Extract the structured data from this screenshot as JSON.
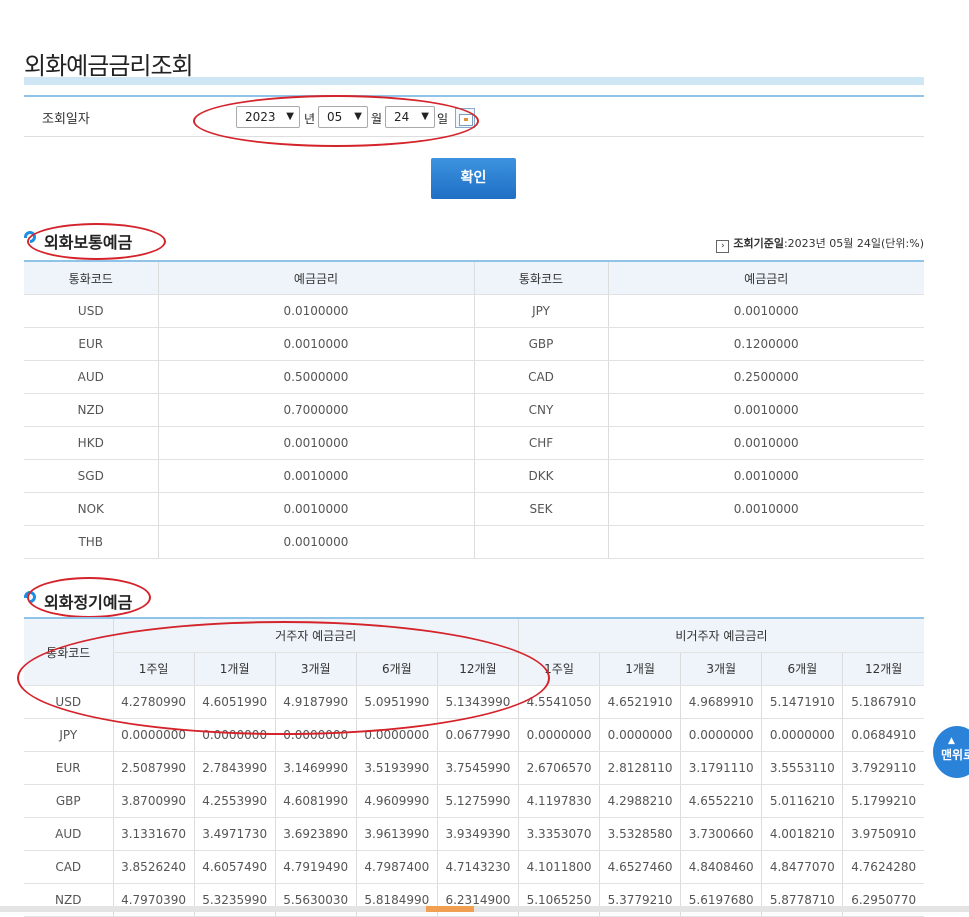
{
  "page": {
    "title": "외화예금금리조회"
  },
  "search": {
    "label": "조회일자",
    "year": "2023",
    "year_unit": "년",
    "month": "05",
    "month_unit": "월",
    "day": "24",
    "day_unit": "일",
    "confirm_label": "확인"
  },
  "ordinary": {
    "title": "외화보통예금",
    "ref_prefix": "조회기준일",
    "ref_text": ":2023년 05월 24일(단위:%)",
    "headers": [
      "통화코드",
      "예금금리",
      "통화코드",
      "예금금리"
    ],
    "rows": [
      [
        "USD",
        "0.0100000",
        "JPY",
        "0.0010000"
      ],
      [
        "EUR",
        "0.0010000",
        "GBP",
        "0.1200000"
      ],
      [
        "AUD",
        "0.5000000",
        "CAD",
        "0.2500000"
      ],
      [
        "NZD",
        "0.7000000",
        "CNY",
        "0.0010000"
      ],
      [
        "HKD",
        "0.0010000",
        "CHF",
        "0.0010000"
      ],
      [
        "SGD",
        "0.0010000",
        "DKK",
        "0.0010000"
      ],
      [
        "NOK",
        "0.0010000",
        "SEK",
        "0.0010000"
      ],
      [
        "THB",
        "0.0010000",
        "",
        ""
      ]
    ]
  },
  "term": {
    "title": "외화정기예금",
    "code_header": "통화코드",
    "resident_header": "거주자 예금금리",
    "nonresident_header": "비거주자 예금금리",
    "periods": [
      "1주일",
      "1개월",
      "3개월",
      "6개월",
      "12개월"
    ],
    "rows": [
      [
        "USD",
        "4.2780990",
        "4.6051990",
        "4.9187990",
        "5.0951990",
        "5.1343990",
        "4.5541050",
        "4.6521910",
        "4.9689910",
        "5.1471910",
        "5.1867910"
      ],
      [
        "JPY",
        "0.0000000",
        "0.0000000",
        "0.0000000",
        "0.0000000",
        "0.0677990",
        "0.0000000",
        "0.0000000",
        "0.0000000",
        "0.0000000",
        "0.0684910"
      ],
      [
        "EUR",
        "2.5087990",
        "2.7843990",
        "3.1469990",
        "3.5193990",
        "3.7545990",
        "2.6706570",
        "2.8128110",
        "3.1791110",
        "3.5553110",
        "3.7929110"
      ],
      [
        "GBP",
        "3.8700990",
        "4.2553990",
        "4.6081990",
        "4.9609990",
        "5.1275990",
        "4.1197830",
        "4.2988210",
        "4.6552210",
        "5.0116210",
        "5.1799210"
      ],
      [
        "AUD",
        "3.1331670",
        "3.4971730",
        "3.6923890",
        "3.9613990",
        "3.9349390",
        "3.3353070",
        "3.5328580",
        "3.7300660",
        "4.0018210",
        "3.9750910"
      ],
      [
        "CAD",
        "3.8526240",
        "4.6057490",
        "4.7919490",
        "4.7987400",
        "4.7143230",
        "4.1011800",
        "4.6527460",
        "4.8408460",
        "4.8477070",
        "4.7624280"
      ],
      [
        "NZD",
        "4.7970390",
        "5.3235990",
        "5.5630030",
        "5.8184990",
        "6.2314900",
        "5.1065250",
        "5.3779210",
        "5.6197680",
        "5.8778710",
        "6.2950770"
      ]
    ]
  },
  "side": {
    "top_label": "맨위로"
  }
}
